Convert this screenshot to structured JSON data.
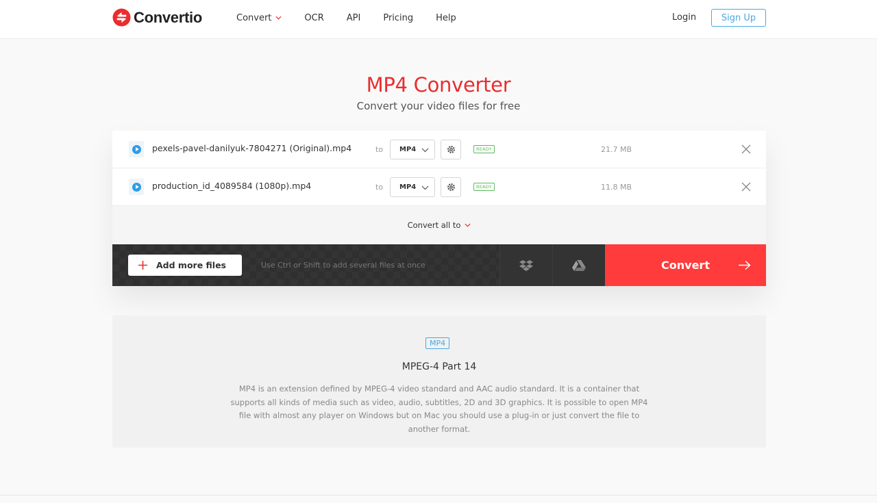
{
  "brand": {
    "name": "Convertio",
    "color": "#ea2d2e"
  },
  "nav": {
    "items": [
      {
        "label": "Convert",
        "dropdown": true
      },
      {
        "label": "OCR"
      },
      {
        "label": "API"
      },
      {
        "label": "Pricing"
      },
      {
        "label": "Help"
      }
    ],
    "login": "Login",
    "signup": "Sign Up"
  },
  "hero": {
    "title": "MP4 Converter",
    "subtitle": "Convert your video files for free"
  },
  "files": [
    {
      "name": "pexels-pavel-danilyuk-7804271 (Original).mp4",
      "to_label": "to",
      "format": "MP4",
      "status": "READY",
      "size": "21.7 MB",
      "icon": "play-icon"
    },
    {
      "name": "production_id_4089584 (1080p).mp4",
      "to_label": "to",
      "format": "MP4",
      "status": "READY",
      "size": "11.8 MB",
      "icon": "play-icon"
    }
  ],
  "convert_all": "Convert all to",
  "toolbar": {
    "add_files": "Add more files",
    "hint": "Use Ctrl or Shift to add several files at once",
    "dropbox_icon": "dropbox-icon",
    "gdrive_icon": "google-drive-icon",
    "convert": "Convert"
  },
  "info": {
    "badge": "MP4",
    "title": "MPEG-4 Part 14",
    "description": "MP4 is an extension defined by MPEG-4 video standard and AAC audio standard. It is a container that supports all kinds of media such as video, audio, subtitles, 2D and 3D graphics. It is possible to open MP4 file with almost any player on Windows but on Mac you should use a plug-in or just convert the file to another format."
  }
}
